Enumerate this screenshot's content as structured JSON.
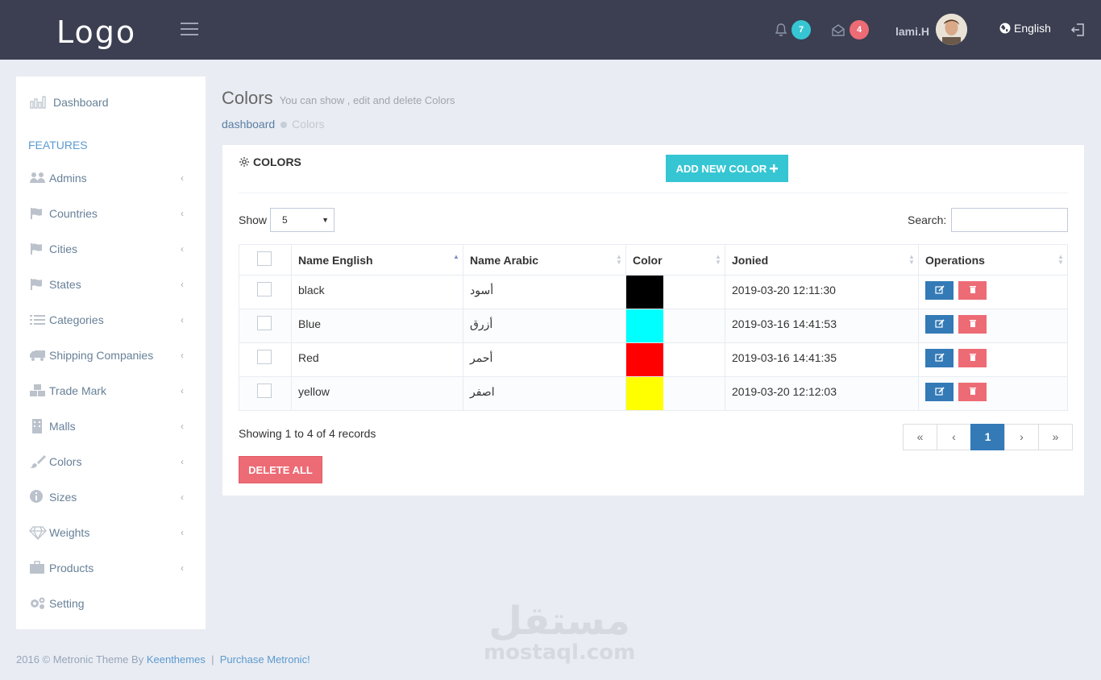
{
  "header": {
    "logo": "Logo",
    "notifications_count": "7",
    "messages_count": "4",
    "username": "lami.H",
    "language": "English"
  },
  "sidebar": {
    "dashboard": "Dashboard",
    "section": "FEATURES",
    "items": [
      {
        "label": "Admins",
        "icon": "users-icon"
      },
      {
        "label": "Countries",
        "icon": "flag-icon"
      },
      {
        "label": "Cities",
        "icon": "flag-icon"
      },
      {
        "label": "States",
        "icon": "flag-icon"
      },
      {
        "label": "Categories",
        "icon": "list-icon"
      },
      {
        "label": "Shipping Companies",
        "icon": "truck-icon"
      },
      {
        "label": "Trade Mark",
        "icon": "cubes-icon"
      },
      {
        "label": "Malls",
        "icon": "building-icon"
      },
      {
        "label": "Colors",
        "icon": "brush-icon"
      },
      {
        "label": "Sizes",
        "icon": "info-icon"
      },
      {
        "label": "Weights",
        "icon": "diamond-icon"
      },
      {
        "label": "Products",
        "icon": "suitcase-icon"
      }
    ],
    "setting": "Setting"
  },
  "page": {
    "title": "Colors",
    "subtitle": "You can show , edit and delete Colors",
    "breadcrumb": [
      "dashboard",
      "Colors"
    ]
  },
  "panel": {
    "title": "COLORS",
    "add_button": "ADD NEW COLOR",
    "show_label": "Show",
    "page_size": "5",
    "search_label": "Search:",
    "search_value": ""
  },
  "table": {
    "columns": [
      "Name English",
      "Name Arabic",
      "Color",
      "Jonied",
      "Operations"
    ],
    "rows": [
      {
        "name_en": "black",
        "name_ar": "أسود",
        "color": "#000000",
        "joined": "2019-03-20 12:11:30"
      },
      {
        "name_en": "Blue",
        "name_ar": "أزرق",
        "color": "#00ffff",
        "joined": "2019-03-16 14:41:53"
      },
      {
        "name_en": "Red",
        "name_ar": "أحمر",
        "color": "#ff0000",
        "joined": "2019-03-16 14:41:35"
      },
      {
        "name_en": "yellow",
        "name_ar": "اصفر",
        "color": "#ffff00",
        "joined": "2019-03-20 12:12:03"
      }
    ]
  },
  "records_text": "Showing 1 to 4 of 4 records",
  "pagination": {
    "first": "«",
    "prev": "‹",
    "current": "1",
    "next": "›",
    "last": "»"
  },
  "delete_all": "DELETE ALL",
  "footer": {
    "text": "2016 © Metronic Theme By",
    "author": "Keenthemes",
    "sep": "|",
    "link": "Purchase Metronic!"
  },
  "watermark": {
    "arabic": "مستقل",
    "latin": "mostaql.com"
  },
  "colors": {
    "header_bg": "#3b3f51",
    "accent": "#36c6d3",
    "danger": "#ed6b75",
    "primary": "#337ab7"
  }
}
